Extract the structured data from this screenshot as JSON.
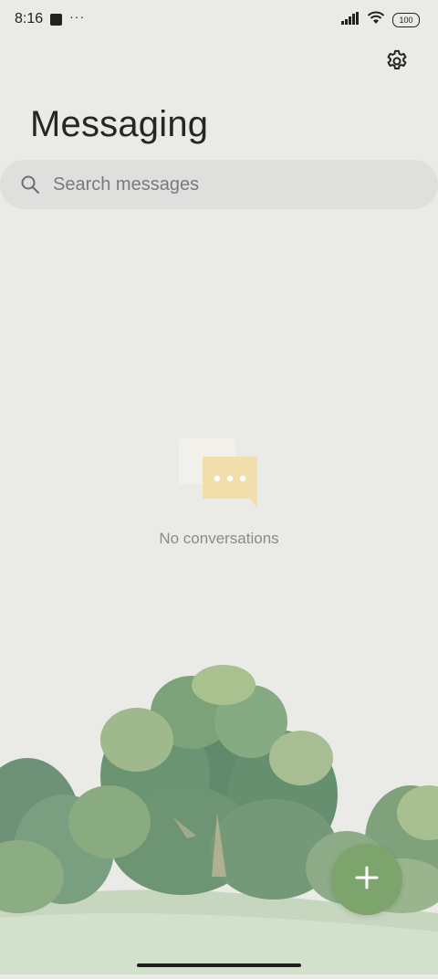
{
  "status_bar": {
    "time": "8:16",
    "notification_dots": "···",
    "battery": "100"
  },
  "header": {
    "title": "Messaging",
    "settings_icon": "gear-icon"
  },
  "search": {
    "placeholder": "Search messages",
    "value": "",
    "icon": "search-icon"
  },
  "empty_state": {
    "text": "No conversations",
    "icon": "chat-bubbles-icon"
  },
  "fab": {
    "icon": "plus-icon"
  },
  "colors": {
    "background": "#eaebe7",
    "search_background": "#dfe0dd",
    "fab": "#7ea46e",
    "empty_bubble": "#f2deaa"
  }
}
